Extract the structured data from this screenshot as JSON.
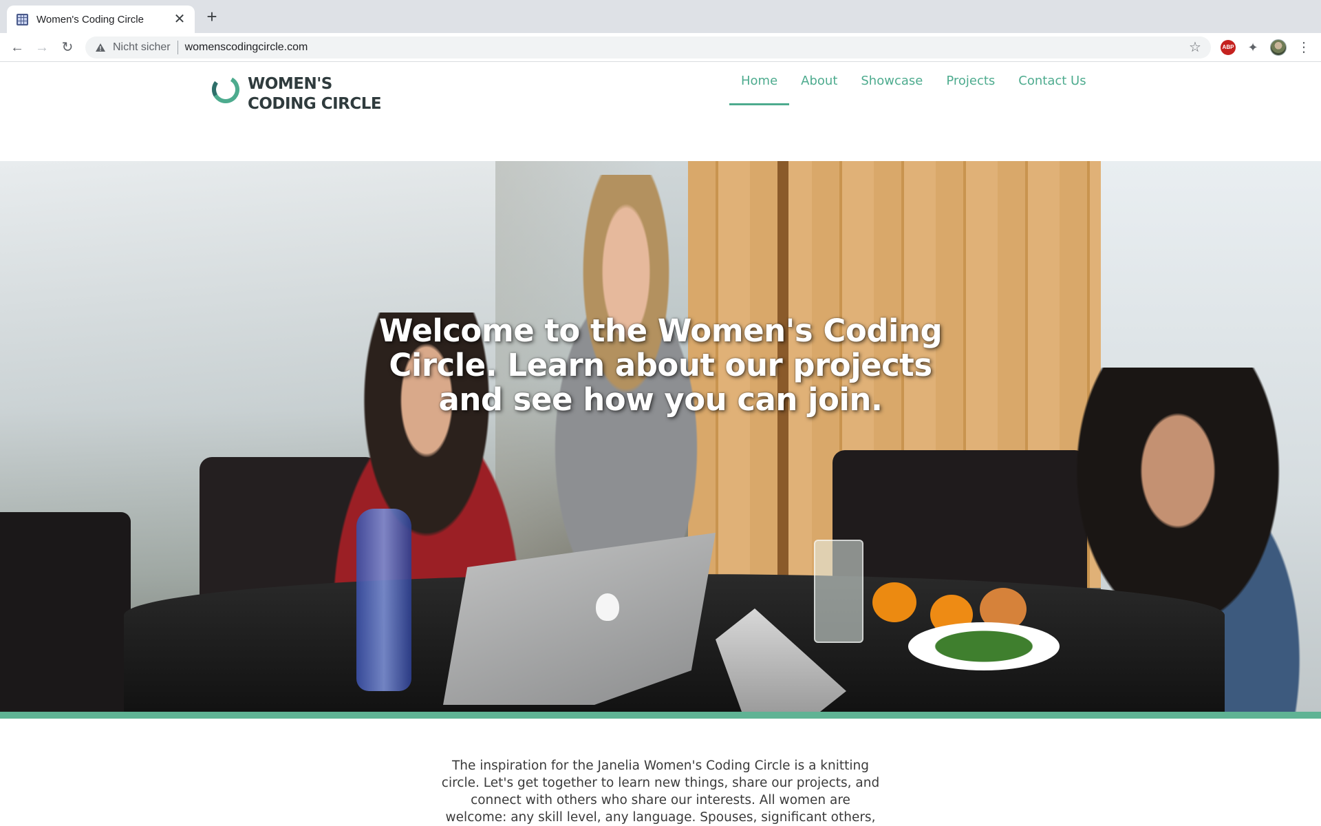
{
  "browser": {
    "tab_title": "Women's Coding Circle",
    "tab_close": "✕",
    "new_tab": "+",
    "back": "←",
    "forward": "→",
    "reload": "↻",
    "security_label": "Nicht sicher",
    "url": "womenscodingcircle.com",
    "bookmark": "☆",
    "abp_label": "ABP",
    "extensions": "✦",
    "menu": "⋮"
  },
  "site": {
    "logo_line1": "WOMEN'S",
    "logo_line2": "CODING CIRCLE",
    "brand_color": "#4dab8e",
    "nav": [
      {
        "label": "Home",
        "active": true
      },
      {
        "label": "About",
        "active": false
      },
      {
        "label": "Showcase",
        "active": false
      },
      {
        "label": "Projects",
        "active": false
      },
      {
        "label": "Contact Us",
        "active": false
      }
    ],
    "hero_title": "Welcome to the Women's Coding Circle. Learn about our projects and see how you can join.",
    "intro": "The inspiration for the Janelia Women's Coding Circle is a knitting circle. Let's get together to learn new things, share our projects, and connect with others who share our interests. All women are welcome: any skill level, any language. Spouses, significant others,"
  }
}
